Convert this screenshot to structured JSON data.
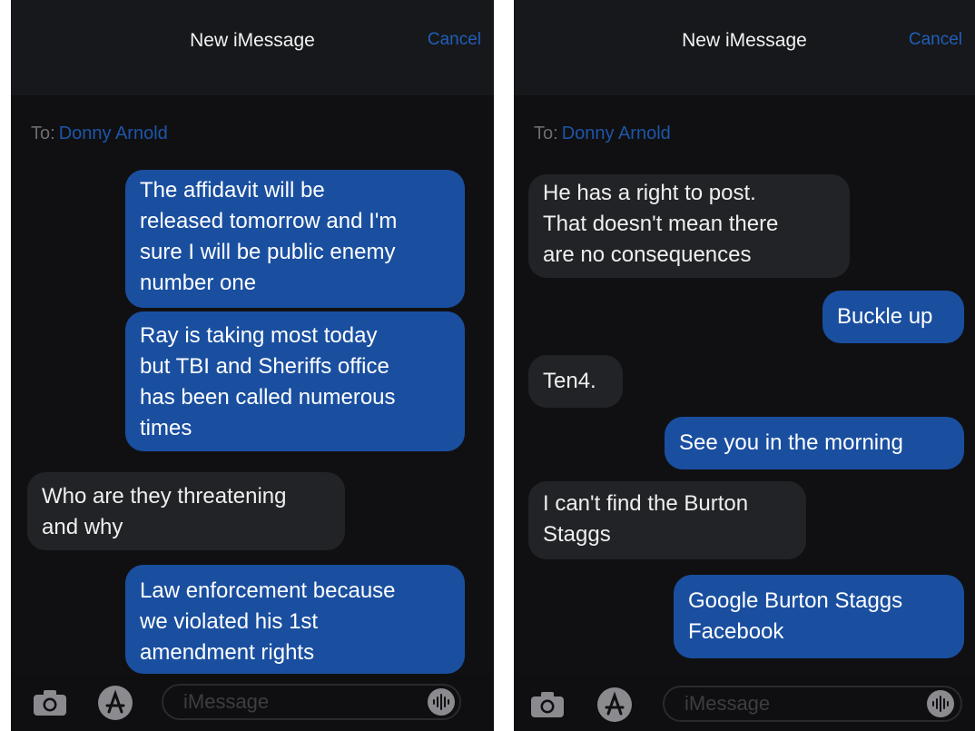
{
  "left": {
    "nav_title": "New iMessage",
    "cancel_label": "Cancel",
    "to_label": "To:",
    "recipient": "Donny Arnold",
    "input_placeholder": "iMessage",
    "messages": [
      {
        "side": "sent",
        "lines": [
          "The affidavit will be",
          "released tomorrow and I'm",
          "sure I will be public enemy",
          "number one"
        ]
      },
      {
        "side": "sent",
        "lines": [
          "Ray is taking most today",
          "but TBI and Sheriffs office",
          "has been called numerous",
          "times"
        ]
      },
      {
        "side": "received",
        "lines": [
          "Who are they threatening",
          "and why"
        ]
      },
      {
        "side": "sent",
        "lines": [
          "Law enforcement because",
          "we violated his 1st",
          "amendment rights"
        ]
      }
    ]
  },
  "right": {
    "nav_title": "New iMessage",
    "cancel_label": "Cancel",
    "to_label": "To:",
    "recipient": "Donny Arnold",
    "input_placeholder": "iMessage",
    "messages": [
      {
        "side": "received",
        "lines": [
          "He has a right to post.",
          "That doesn't mean there",
          "are no consequences"
        ]
      },
      {
        "side": "sent",
        "lines": [
          "Buckle up"
        ]
      },
      {
        "side": "received",
        "lines": [
          "Ten4."
        ]
      },
      {
        "side": "sent",
        "lines": [
          "See you in the morning"
        ]
      },
      {
        "side": "received",
        "lines": [
          "I can't find the Burton",
          "Staggs"
        ]
      },
      {
        "side": "sent",
        "lines": [
          "Google Burton Staggs",
          "Facebook"
        ]
      }
    ]
  },
  "icons": {
    "camera": "camera-icon",
    "apps": "app-store-icon",
    "audio": "audio-waveform-icon"
  },
  "colors": {
    "sent_bubble": "#1a4fa0",
    "received_bubble": "#222326",
    "background": "#101012",
    "accent": "#1f5fb8"
  }
}
